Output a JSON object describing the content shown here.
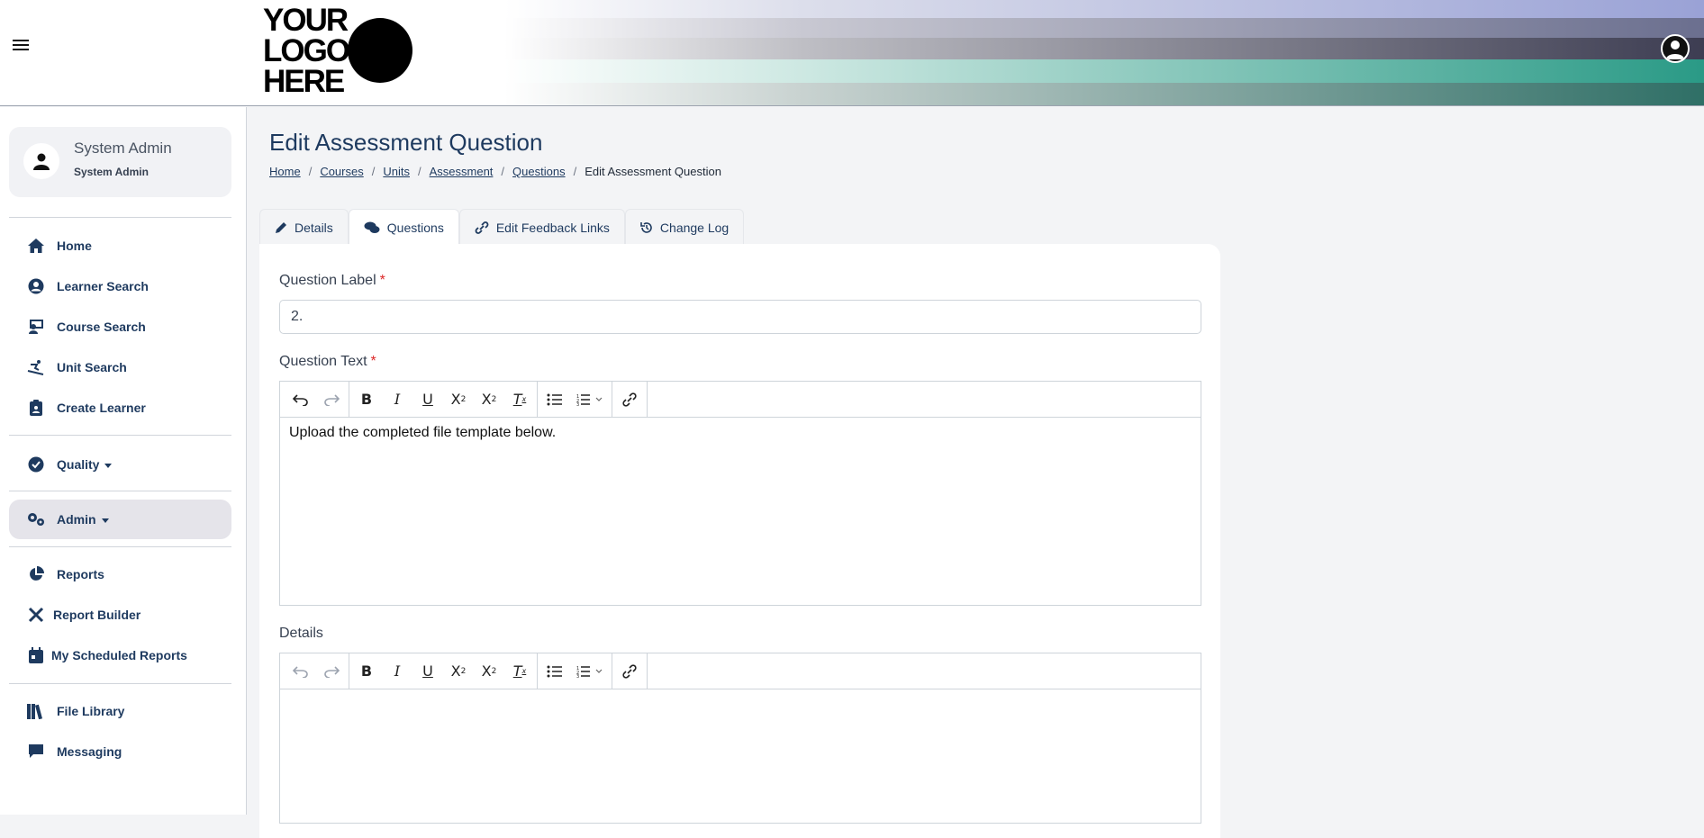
{
  "header": {
    "logo_text": "YOUR\nLOGO\nHERE",
    "stripe_colors": [
      "#9aa2d6",
      "#6b6f8f",
      "#3d3d52",
      "#2a9a86",
      "#2f6f66"
    ]
  },
  "sidebar": {
    "profile": {
      "name": "System Admin",
      "role": "System Admin"
    },
    "items": [
      {
        "label": "Home",
        "icon": "home-icon"
      },
      {
        "label": "Learner Search",
        "icon": "user-circle-icon"
      },
      {
        "label": "Course Search",
        "icon": "teacher-icon"
      },
      {
        "label": "Unit Search",
        "icon": "skier-icon"
      },
      {
        "label": "Create Learner",
        "icon": "clipboard-icon"
      },
      {
        "label": "Quality",
        "icon": "check-circle-icon"
      },
      {
        "label": "Admin",
        "icon": "gears-icon"
      },
      {
        "label": "Reports",
        "icon": "pie-chart-icon"
      },
      {
        "label": "Report Builder",
        "icon": "tools-icon"
      },
      {
        "label": "My Scheduled Reports",
        "icon": "calendar-icon"
      },
      {
        "label": "File Library",
        "icon": "books-icon"
      },
      {
        "label": "Messaging",
        "icon": "message-icon"
      }
    ]
  },
  "main": {
    "title": "Edit Assessment Question",
    "breadcrumb": [
      "Home",
      "Courses",
      "Units",
      "Assessment",
      "Questions",
      "Edit Assessment Question"
    ],
    "tabs": [
      {
        "label": "Details"
      },
      {
        "label": "Questions"
      },
      {
        "label": "Edit Feedback Links"
      },
      {
        "label": "Change Log"
      }
    ],
    "question_label": {
      "label": "Question Label",
      "required_mark": "*",
      "value": "2."
    },
    "question_text": {
      "label": "Question Text",
      "required_mark": "*",
      "value": "Upload the completed file template below."
    },
    "details": {
      "label": "Details",
      "value": ""
    }
  }
}
